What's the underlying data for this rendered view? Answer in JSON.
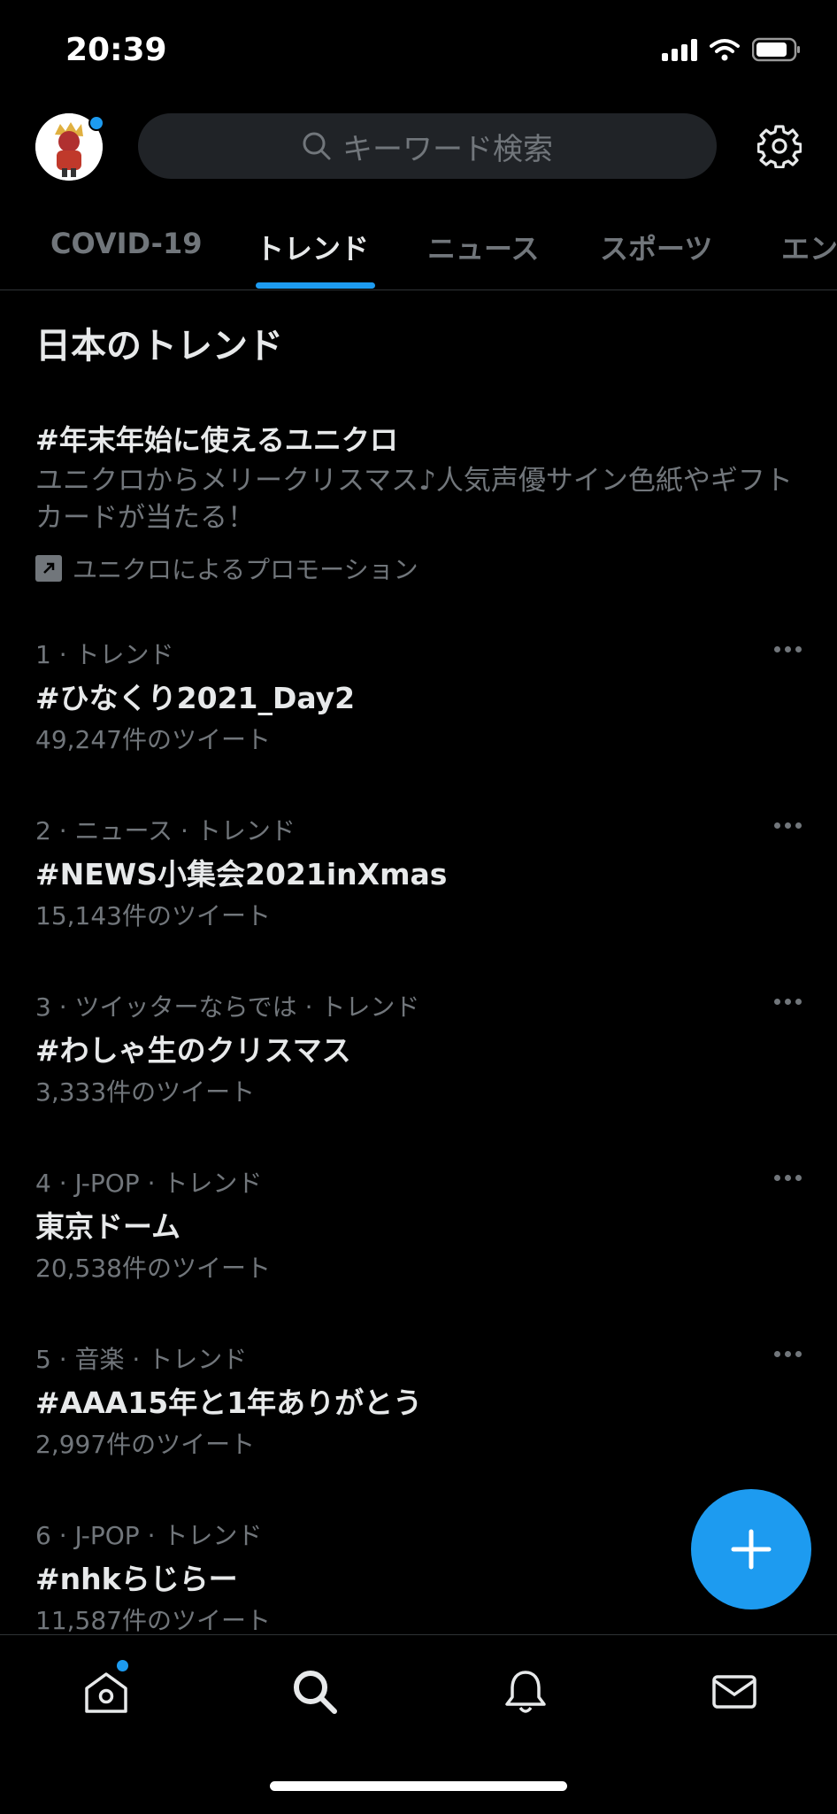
{
  "status_bar": {
    "time": "20:39"
  },
  "header": {
    "search_placeholder": "キーワード検索",
    "avatar_icon": "profile-avatar",
    "settings_icon": "gear-icon"
  },
  "tabs": [
    {
      "label": "COVID-19",
      "active": false
    },
    {
      "label": "トレンド",
      "active": true
    },
    {
      "label": "ニュース",
      "active": false
    },
    {
      "label": "スポーツ",
      "active": false
    },
    {
      "label": "エン",
      "active": false
    }
  ],
  "section_title": "日本のトレンド",
  "promo": {
    "title": "#年末年始に使えるユニクロ",
    "description": "ユニクロからメリークリスマス♪人気声優サイン色紙やギフトカードが当たる！",
    "promoted_by": "ユニクロによるプロモーション"
  },
  "trends": [
    {
      "meta": "1 · トレンド",
      "name": "#ひなくり2021_Day2",
      "count": "49,247件のツイート"
    },
    {
      "meta": "2 · ニュース · トレンド",
      "name": "#NEWS小集会2021inXmas",
      "count": "15,143件のツイート"
    },
    {
      "meta": "3 · ツイッターならでは · トレンド",
      "name": "#わしゃ生のクリスマス",
      "count": "3,333件のツイート"
    },
    {
      "meta": "4 · J-POP · トレンド",
      "name": "東京ドーム",
      "count": "20,538件のツイート"
    },
    {
      "meta": "5 · 音楽 · トレンド",
      "name": "#AAA15年と1年ありがとう",
      "count": "2,997件のツイート"
    },
    {
      "meta": "6 · J-POP · トレンド",
      "name": "#nhkらじらー",
      "count": "11,587件のツイート"
    }
  ],
  "colors": {
    "accent": "#1d9bf0",
    "background": "#000000",
    "secondary_text": "#71767b"
  },
  "bottom_nav": [
    "home-icon",
    "search-icon",
    "bell-icon",
    "mail-icon"
  ]
}
